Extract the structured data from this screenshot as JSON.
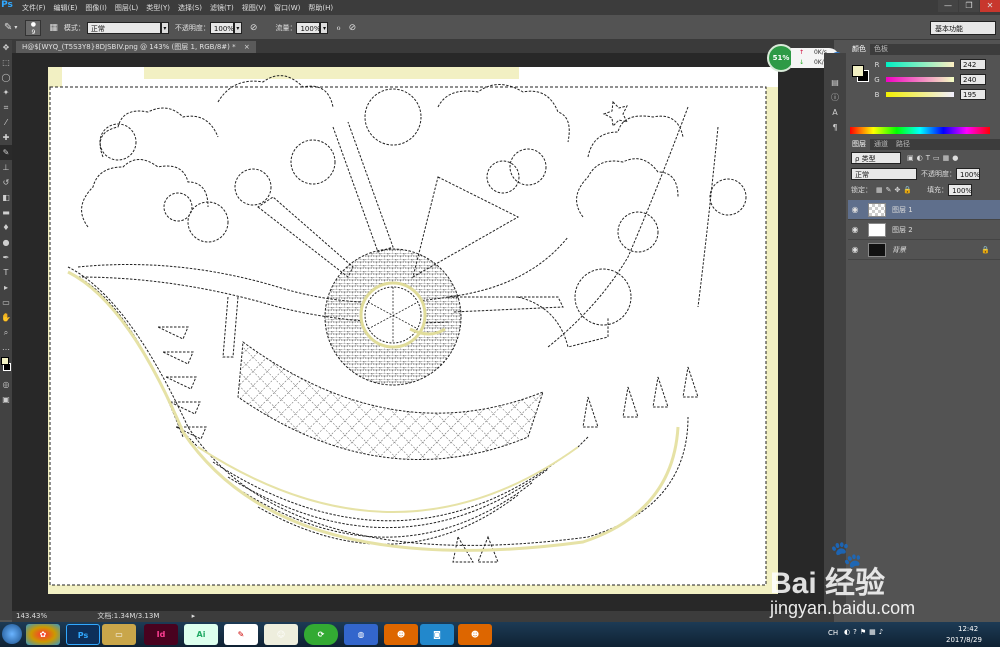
{
  "menubar": {
    "app_icon": "Ps",
    "items": [
      "文件(F)",
      "编辑(E)",
      "图像(I)",
      "图层(L)",
      "类型(Y)",
      "选择(S)",
      "滤镜(T)",
      "视图(V)",
      "窗口(W)",
      "帮助(H)"
    ],
    "window_controls": [
      "—",
      "❐",
      "✕"
    ]
  },
  "options": {
    "brush_size": "9",
    "mode_label": "模式：",
    "mode_value": "正常",
    "opacity_label": "不透明度：",
    "opacity_value": "100%",
    "flow_label": "流量：",
    "flow_value": "100%",
    "workspace": "基本功能"
  },
  "document": {
    "tab_title": "H@$[WYQ_(T5S3Y8}8DJSBIV.png @ 143% (图层 1, RGB/8#) *",
    "close": "×"
  },
  "netmon": {
    "percent": "51%",
    "up": "0K/s",
    "down": "0K/s"
  },
  "status": {
    "zoom": "143.43%",
    "doc": "文档:1.34M/3.13M"
  },
  "color_panel": {
    "tabs": [
      "颜色",
      "色板"
    ],
    "r_label": "R",
    "r": "242",
    "g_label": "G",
    "g": "240",
    "b_label": "B",
    "b": "195"
  },
  "layers_panel": {
    "tabs": [
      "图层",
      "通道",
      "路径"
    ],
    "filter": "ρ 类型",
    "blend": "正常",
    "opacity_label": "不透明度：",
    "opacity": "100%",
    "lock_label": "锁定：",
    "fill_label": "填充：",
    "fill": "100%",
    "layers": [
      {
        "name": "图层 1"
      },
      {
        "name": "图层 2"
      },
      {
        "name": "背景"
      }
    ]
  },
  "taskbar": {
    "apps": [
      "Ps",
      "Id",
      "Ai"
    ],
    "tray_lang": "CH",
    "time": "12:42",
    "date": "2017/8/29"
  },
  "watermark": {
    "brand": "Bai  经验",
    "url": "jingyan.baidu.com"
  },
  "colors": {
    "selection_fill": "#f2f0c3",
    "accent": "#31a8ff"
  }
}
